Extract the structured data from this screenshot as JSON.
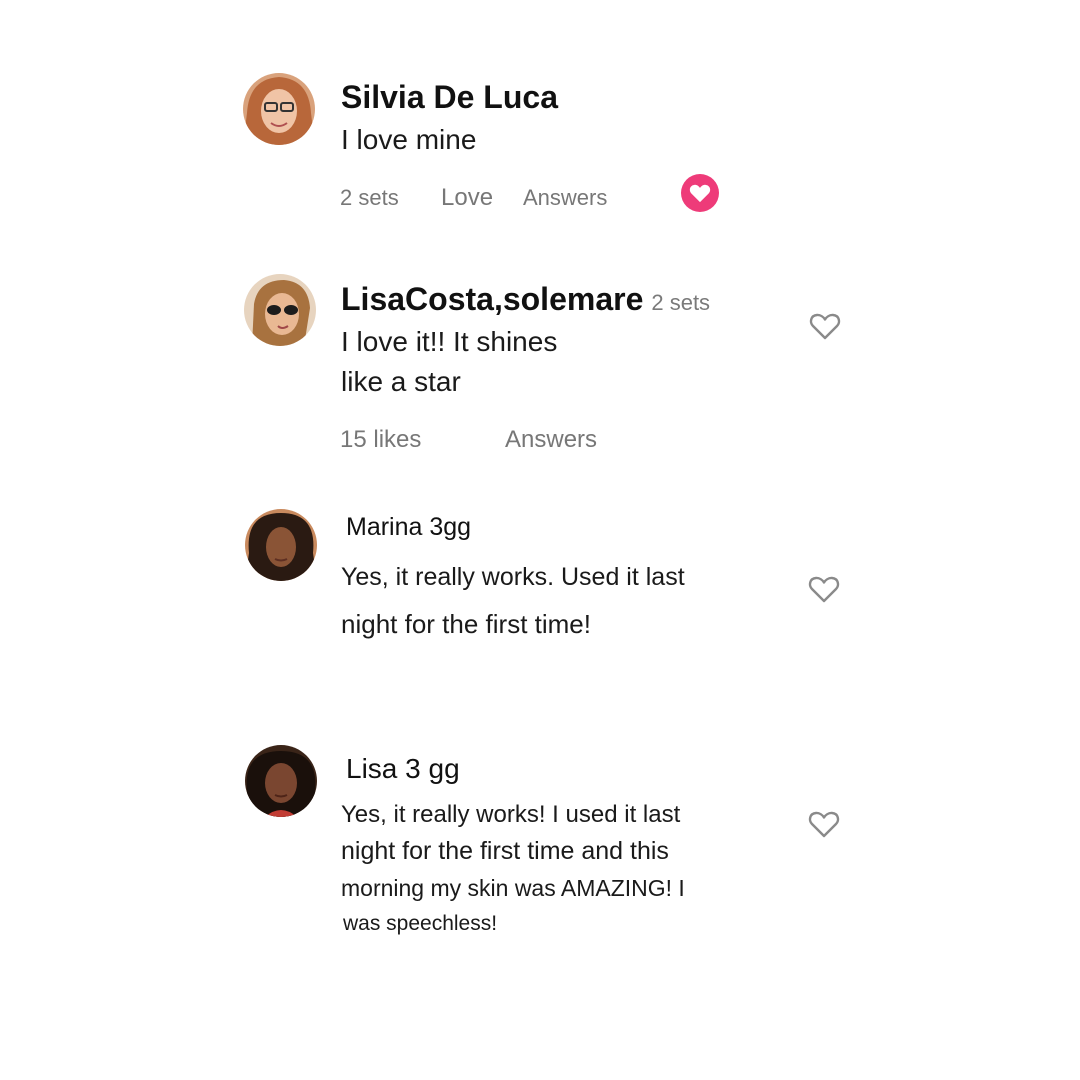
{
  "comments": [
    {
      "name": "Silvia De Luca",
      "text_lines": [
        "I love mine"
      ],
      "meta": [
        "2 sets",
        "Love",
        "Answers"
      ],
      "liked": true
    },
    {
      "name": "LisaCosta,solemare",
      "name_meta": "2 sets",
      "text_lines": [
        "I love it!! It shines",
        "like a star"
      ],
      "meta": [
        "15 likes",
        "Answers"
      ],
      "liked": false
    },
    {
      "name": "Marina 3gg",
      "text_lines": [
        "Yes, it really works. Used it last",
        "night for the first time!"
      ],
      "liked": false
    },
    {
      "name": "Lisa 3 gg",
      "text_lines": [
        "Yes, it really works! I used it last",
        "night for the first time and this",
        "morning my skin was AMAZING! I",
        "was speechless!"
      ],
      "liked": false
    }
  ],
  "colors": {
    "like_active": "#ee3b79",
    "meta_text": "#777777",
    "heart_outline": "#8a8a8a"
  },
  "icons": {
    "like": "heart-icon",
    "like_active": "heart-filled-icon"
  }
}
